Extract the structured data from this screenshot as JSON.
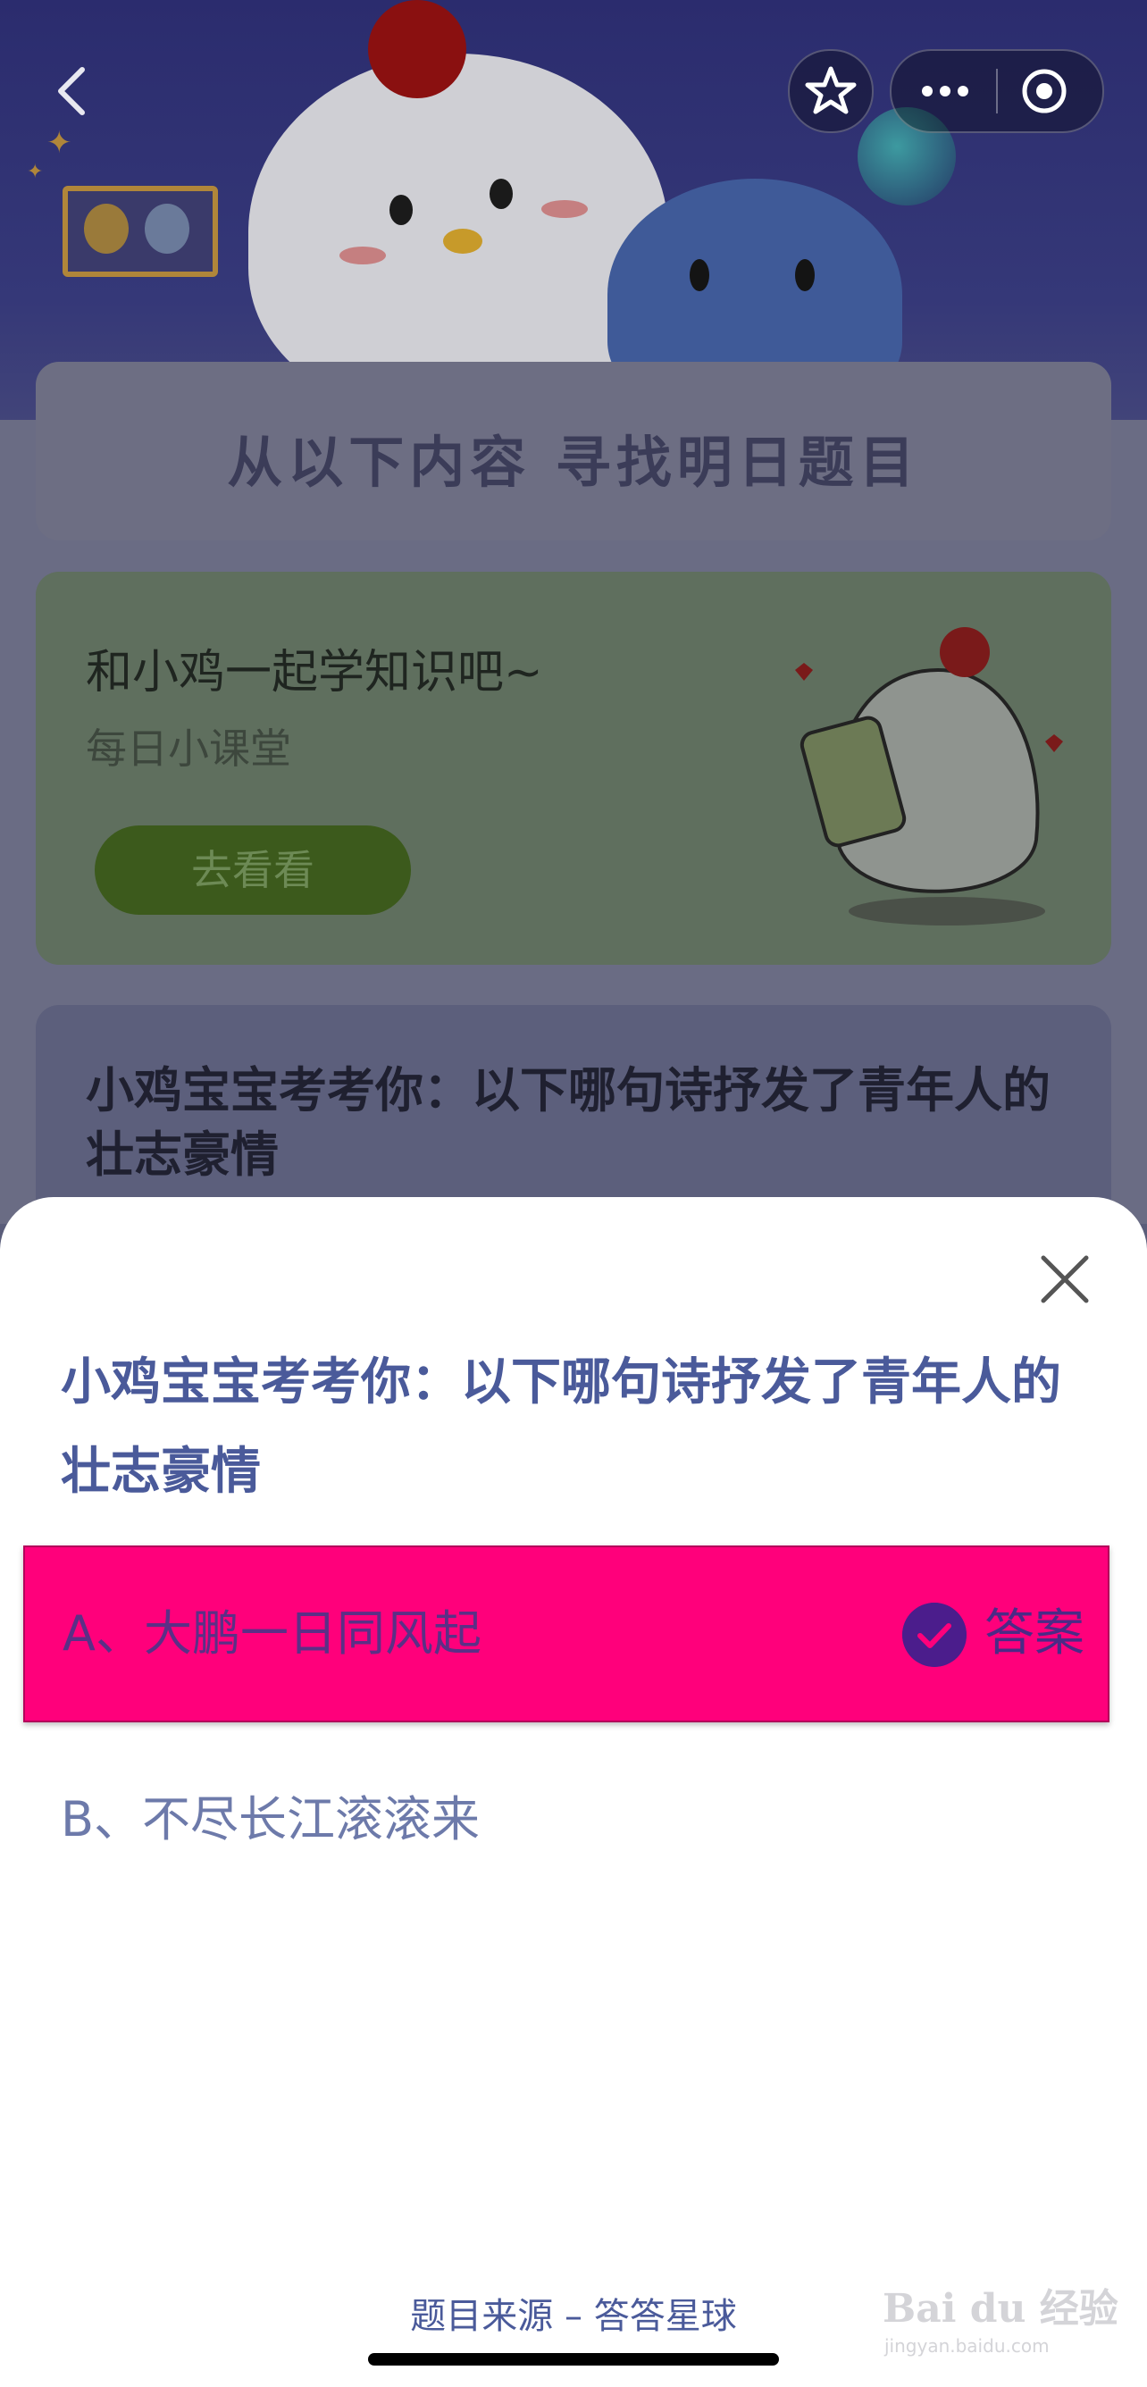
{
  "nav": {
    "back_icon": "chevron-left-icon",
    "favorite_icon": "star-icon",
    "more_icon": "more-dots-icon",
    "close_app_icon": "target-circle-icon"
  },
  "background": {
    "section_title": "从以下内容 寻找明日题目",
    "lesson_card": {
      "title": "和小鸡一起学知识吧~",
      "subtitle": "每日小课堂",
      "button_label": "去看看"
    },
    "quiz_card": {
      "question": "小鸡宝宝考考你：以下哪句诗抒发了青年人的壮志豪情"
    }
  },
  "sheet": {
    "close_icon": "close-icon",
    "question": "小鸡宝宝考考你：以下哪句诗抒发了青年人的壮志豪情",
    "options": [
      {
        "label": "A、大鹏一日同风起",
        "is_answer": true
      },
      {
        "label": "B、不尽长江滚滚来",
        "is_answer": false
      }
    ],
    "answer_tag": "答案",
    "source": "题目来源 – 答答星球"
  },
  "watermark": {
    "brand": "Bai du 经验",
    "url": "jingyan.baidu.com"
  },
  "colors": {
    "answer_highlight": "#ff007b",
    "question_text": "#4a5a9a",
    "check_badge": "#4b1d8c"
  }
}
